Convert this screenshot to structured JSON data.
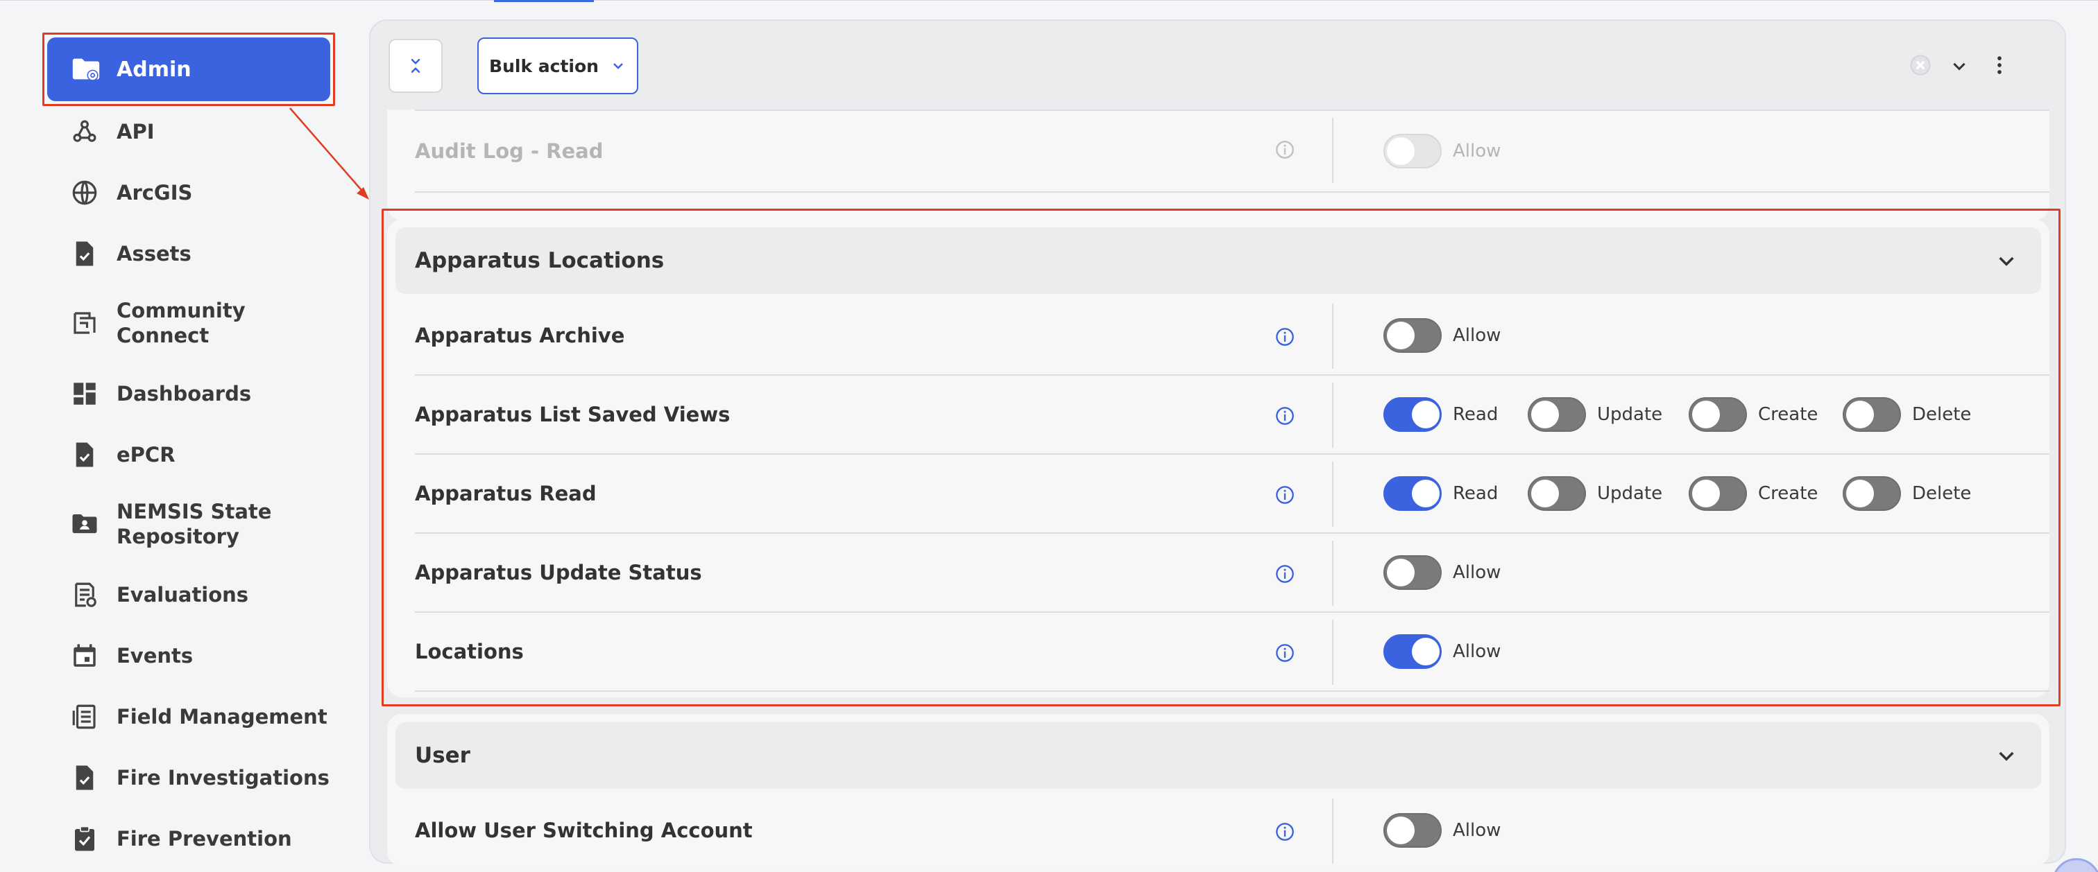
{
  "sidebar": {
    "items": [
      {
        "label": "Admin",
        "icon": "folder-gear-icon"
      },
      {
        "label": "API",
        "icon": "webhook-icon"
      },
      {
        "label": "ArcGIS",
        "icon": "globe-icon"
      },
      {
        "label": "Assets",
        "icon": "file-check-icon"
      },
      {
        "label": "Community",
        "label2": "Connect",
        "icon": "community-icon"
      },
      {
        "label": "Dashboards",
        "icon": "dashboard-icon"
      },
      {
        "label": "ePCR",
        "icon": "file-check-icon"
      },
      {
        "label": "NEMSIS State",
        "label2": "Repository",
        "icon": "folder-user-icon"
      },
      {
        "label": "Evaluations",
        "icon": "evaluation-icon"
      },
      {
        "label": "Events",
        "icon": "calendar-icon"
      },
      {
        "label": "Field Management",
        "icon": "field-management-icon"
      },
      {
        "label": "Fire Investigations",
        "icon": "file-search-icon"
      },
      {
        "label": "Fire Prevention",
        "icon": "clipboard-check-icon"
      }
    ]
  },
  "toolbar": {
    "bulk_action_label": "Bulk action"
  },
  "sections": {
    "audit": {
      "rows": [
        {
          "label": "Audit Log - Read",
          "perms": [
            {
              "label": "Allow",
              "on": false
            }
          ]
        }
      ]
    },
    "apparatus": {
      "title": "Apparatus Locations",
      "rows": [
        {
          "label": "Apparatus Archive",
          "perms": [
            {
              "label": "Allow",
              "on": false
            }
          ]
        },
        {
          "label": "Apparatus List Saved Views",
          "perms": [
            {
              "label": "Read",
              "on": true
            },
            {
              "label": "Update",
              "on": false
            },
            {
              "label": "Create",
              "on": false
            },
            {
              "label": "Delete",
              "on": false
            }
          ]
        },
        {
          "label": "Apparatus Read",
          "perms": [
            {
              "label": "Read",
              "on": true
            },
            {
              "label": "Update",
              "on": false
            },
            {
              "label": "Create",
              "on": false
            },
            {
              "label": "Delete",
              "on": false
            }
          ]
        },
        {
          "label": "Apparatus Update Status",
          "perms": [
            {
              "label": "Allow",
              "on": false
            }
          ]
        },
        {
          "label": "Locations",
          "perms": [
            {
              "label": "Allow",
              "on": true
            }
          ]
        }
      ]
    },
    "user": {
      "title": "User",
      "rows": [
        {
          "label": "Allow User Switching Account",
          "perms": [
            {
              "label": "Allow",
              "on": false
            }
          ]
        }
      ]
    }
  },
  "colors": {
    "accent": "#3b63e0",
    "highlight": "#e03c22",
    "toggle_off": "#7a7a7a"
  }
}
